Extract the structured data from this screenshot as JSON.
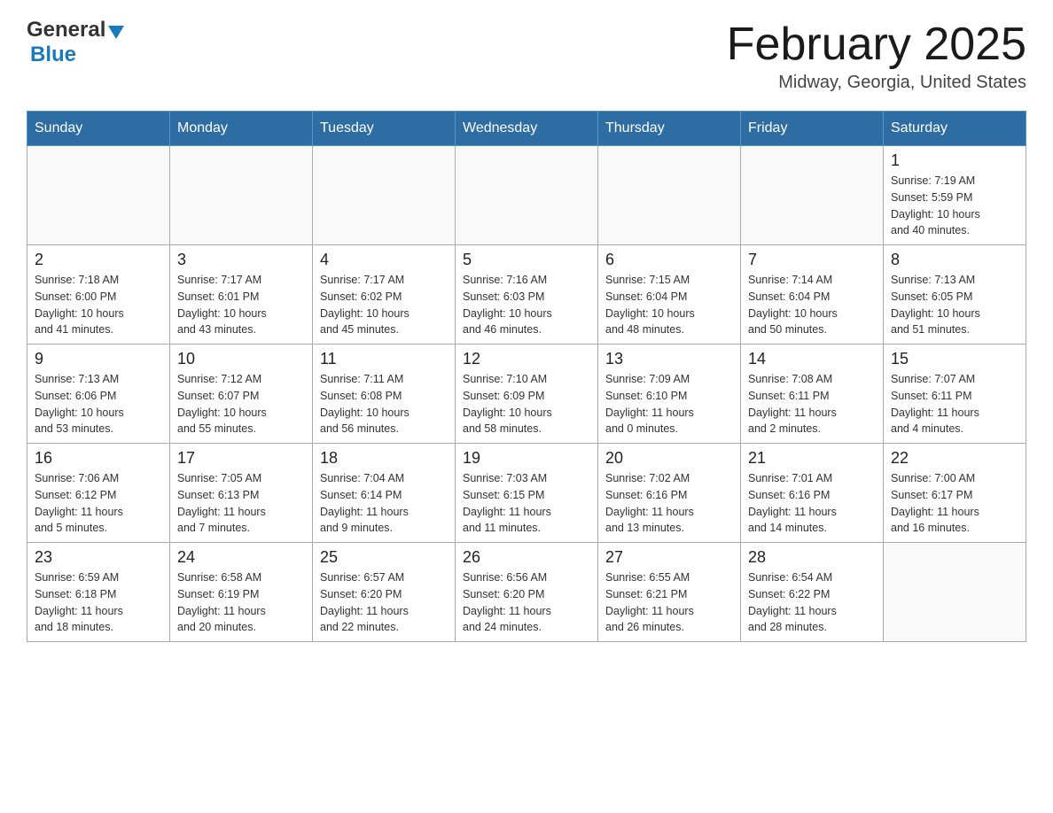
{
  "header": {
    "logo": {
      "general": "General",
      "blue": "Blue",
      "triangle": "▲"
    },
    "title": "February 2025",
    "location": "Midway, Georgia, United States"
  },
  "calendar": {
    "weekdays": [
      "Sunday",
      "Monday",
      "Tuesday",
      "Wednesday",
      "Thursday",
      "Friday",
      "Saturday"
    ],
    "weeks": [
      [
        {
          "day": "",
          "info": ""
        },
        {
          "day": "",
          "info": ""
        },
        {
          "day": "",
          "info": ""
        },
        {
          "day": "",
          "info": ""
        },
        {
          "day": "",
          "info": ""
        },
        {
          "day": "",
          "info": ""
        },
        {
          "day": "1",
          "info": "Sunrise: 7:19 AM\nSunset: 5:59 PM\nDaylight: 10 hours\nand 40 minutes."
        }
      ],
      [
        {
          "day": "2",
          "info": "Sunrise: 7:18 AM\nSunset: 6:00 PM\nDaylight: 10 hours\nand 41 minutes."
        },
        {
          "day": "3",
          "info": "Sunrise: 7:17 AM\nSunset: 6:01 PM\nDaylight: 10 hours\nand 43 minutes."
        },
        {
          "day": "4",
          "info": "Sunrise: 7:17 AM\nSunset: 6:02 PM\nDaylight: 10 hours\nand 45 minutes."
        },
        {
          "day": "5",
          "info": "Sunrise: 7:16 AM\nSunset: 6:03 PM\nDaylight: 10 hours\nand 46 minutes."
        },
        {
          "day": "6",
          "info": "Sunrise: 7:15 AM\nSunset: 6:04 PM\nDaylight: 10 hours\nand 48 minutes."
        },
        {
          "day": "7",
          "info": "Sunrise: 7:14 AM\nSunset: 6:04 PM\nDaylight: 10 hours\nand 50 minutes."
        },
        {
          "day": "8",
          "info": "Sunrise: 7:13 AM\nSunset: 6:05 PM\nDaylight: 10 hours\nand 51 minutes."
        }
      ],
      [
        {
          "day": "9",
          "info": "Sunrise: 7:13 AM\nSunset: 6:06 PM\nDaylight: 10 hours\nand 53 minutes."
        },
        {
          "day": "10",
          "info": "Sunrise: 7:12 AM\nSunset: 6:07 PM\nDaylight: 10 hours\nand 55 minutes."
        },
        {
          "day": "11",
          "info": "Sunrise: 7:11 AM\nSunset: 6:08 PM\nDaylight: 10 hours\nand 56 minutes."
        },
        {
          "day": "12",
          "info": "Sunrise: 7:10 AM\nSunset: 6:09 PM\nDaylight: 10 hours\nand 58 minutes."
        },
        {
          "day": "13",
          "info": "Sunrise: 7:09 AM\nSunset: 6:10 PM\nDaylight: 11 hours\nand 0 minutes."
        },
        {
          "day": "14",
          "info": "Sunrise: 7:08 AM\nSunset: 6:11 PM\nDaylight: 11 hours\nand 2 minutes."
        },
        {
          "day": "15",
          "info": "Sunrise: 7:07 AM\nSunset: 6:11 PM\nDaylight: 11 hours\nand 4 minutes."
        }
      ],
      [
        {
          "day": "16",
          "info": "Sunrise: 7:06 AM\nSunset: 6:12 PM\nDaylight: 11 hours\nand 5 minutes."
        },
        {
          "day": "17",
          "info": "Sunrise: 7:05 AM\nSunset: 6:13 PM\nDaylight: 11 hours\nand 7 minutes."
        },
        {
          "day": "18",
          "info": "Sunrise: 7:04 AM\nSunset: 6:14 PM\nDaylight: 11 hours\nand 9 minutes."
        },
        {
          "day": "19",
          "info": "Sunrise: 7:03 AM\nSunset: 6:15 PM\nDaylight: 11 hours\nand 11 minutes."
        },
        {
          "day": "20",
          "info": "Sunrise: 7:02 AM\nSunset: 6:16 PM\nDaylight: 11 hours\nand 13 minutes."
        },
        {
          "day": "21",
          "info": "Sunrise: 7:01 AM\nSunset: 6:16 PM\nDaylight: 11 hours\nand 14 minutes."
        },
        {
          "day": "22",
          "info": "Sunrise: 7:00 AM\nSunset: 6:17 PM\nDaylight: 11 hours\nand 16 minutes."
        }
      ],
      [
        {
          "day": "23",
          "info": "Sunrise: 6:59 AM\nSunset: 6:18 PM\nDaylight: 11 hours\nand 18 minutes."
        },
        {
          "day": "24",
          "info": "Sunrise: 6:58 AM\nSunset: 6:19 PM\nDaylight: 11 hours\nand 20 minutes."
        },
        {
          "day": "25",
          "info": "Sunrise: 6:57 AM\nSunset: 6:20 PM\nDaylight: 11 hours\nand 22 minutes."
        },
        {
          "day": "26",
          "info": "Sunrise: 6:56 AM\nSunset: 6:20 PM\nDaylight: 11 hours\nand 24 minutes."
        },
        {
          "day": "27",
          "info": "Sunrise: 6:55 AM\nSunset: 6:21 PM\nDaylight: 11 hours\nand 26 minutes."
        },
        {
          "day": "28",
          "info": "Sunrise: 6:54 AM\nSunset: 6:22 PM\nDaylight: 11 hours\nand 28 minutes."
        },
        {
          "day": "",
          "info": ""
        }
      ]
    ]
  }
}
